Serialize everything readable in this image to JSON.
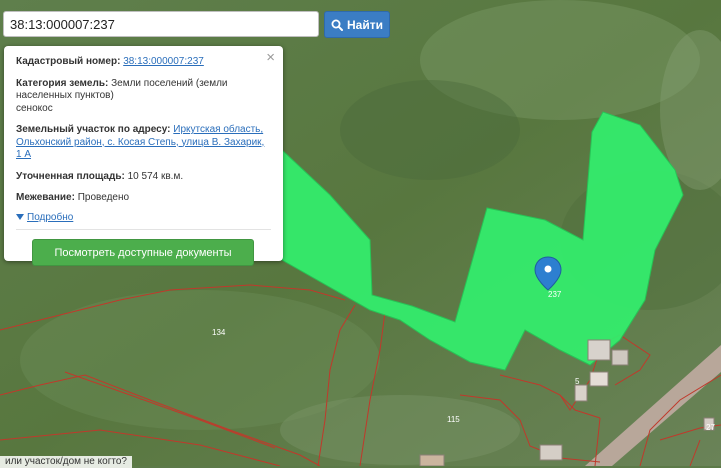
{
  "search": {
    "value": "38:13:000007:237",
    "button_label": "Найти"
  },
  "popup": {
    "close": "×",
    "cadastral_label": "Кадастровый номер:",
    "cadastral_value": "38:13:000007:237",
    "category_label": "Категория земель:",
    "category_value": "Земли поселений (земли населенных пунктов)",
    "use_value": "сенокос",
    "address_label": "Земельный участок по адресу:",
    "address_value": "Иркутская область, Ольхонский район, с. Косая Степь, улица В. Захарик, 1 А",
    "area_label": "Уточненная площадь:",
    "area_value": "10 574 кв.м.",
    "survey_label": "Межевание:",
    "survey_value": "Проведено",
    "more_label": "Подробно",
    "docs_button": "Посмотреть доступные документы"
  },
  "map": {
    "parcel_labels": [
      "237",
      "134",
      "115",
      "5",
      "27"
    ],
    "colors": {
      "parcel_fill": "#33ef6d",
      "boundary": "#c0392b",
      "pin": "#2d7fd0"
    }
  },
  "bottom_text": "или участок/дом не когто?"
}
